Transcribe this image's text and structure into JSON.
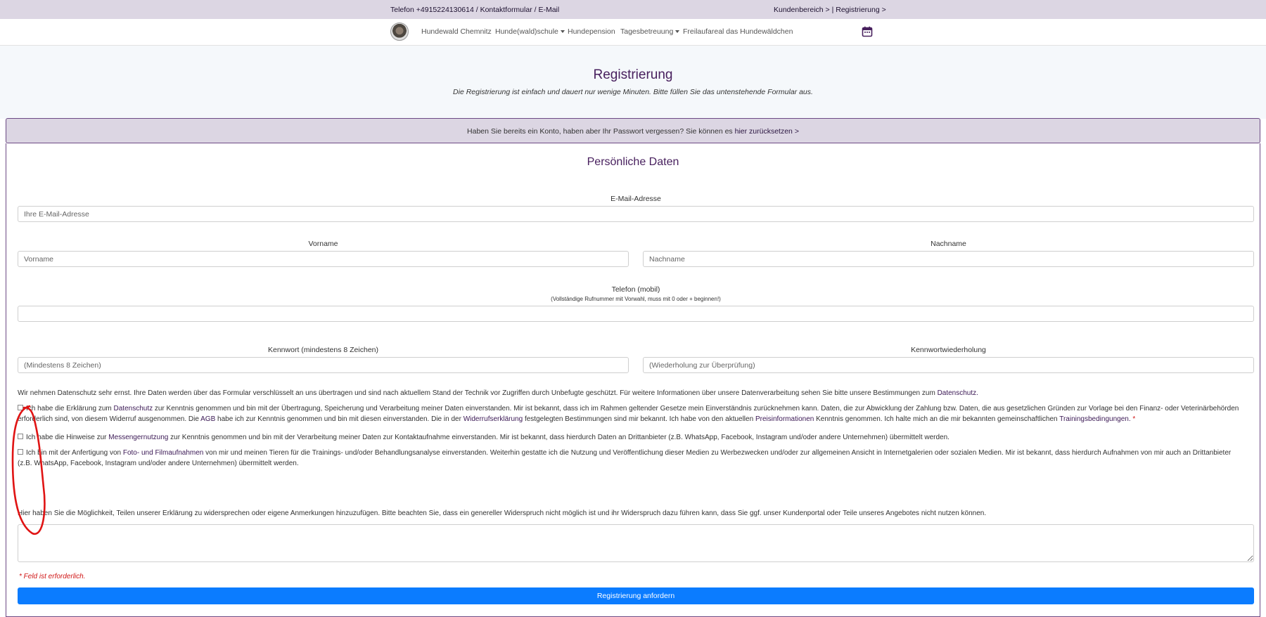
{
  "topbar": {
    "contact": "Telefon +4915224130614 / Kontaktformular / E-Mail",
    "customer": "Kundenbereich > | Registrierung >"
  },
  "nav": {
    "items": [
      "Hundewald Chemnitz",
      "Hunde(wald)schule",
      "Hundepension",
      "Tagesbetreuung",
      "Freilaufareal das Hundewäldchen"
    ],
    "icons": [
      "logo",
      "calendar-icon"
    ]
  },
  "hero": {
    "title": "Registrierung",
    "subtitle": "Die Registrierung ist einfach und dauert nur wenige Minuten. Bitte füllen Sie das untenstehende Formular aus."
  },
  "password_notice": {
    "text": "Haben Sie bereits ein Konto, haben aber Ihr Passwort vergessen? Sie können es ",
    "link": "hier zurücksetzen >"
  },
  "form": {
    "section_title": "Persönliche Daten",
    "email_label": "E-Mail-Adresse",
    "email_placeholder": "Ihre E-Mail-Adresse",
    "firstname_label": "Vorname",
    "firstname_placeholder": "Vorname",
    "lastname_label": "Nachname",
    "lastname_placeholder": "Nachname",
    "phone_label": "Telefon (mobil)",
    "phone_hint": "(Vollständige Rufnummer mit Vorwahl, muss mit 0 oder + beginnen!)",
    "password_label": "Kennwort (mindestens 8 Zeichen)",
    "password_placeholder": "(Mindestens 8 Zeichen)",
    "password_repeat_label": "Kennwortwiederholung",
    "password_repeat_placeholder": "(Wiederholung zur Überprüfung)",
    "privacy_intro": "Wir nehmen Datenschutz sehr ernst. Ihre Daten werden über das Formular verschlüsselt an uns übertragen und sind nach aktuellem Stand der Technik vor Zugriffen durch Unbefugte geschützt. Für weitere Informationen über unsere Datenverarbeitung sehen Sie bitte unsere Bestimmungen zum ",
    "privacy_intro_link": "Datenschutz.",
    "consent1": {
      "p1": "Ich habe die Erklärung zum ",
      "l1": "Datenschutz",
      "p2": " zur Kenntnis genommen und bin mit der Übertragung, Speicherung und Verarbeitung meiner Daten einverstanden. Mir ist bekannt, dass ich im Rahmen geltender Gesetze mein Einverständnis zurücknehmen kann. Daten, die zur Abwicklung der Zahlung bzw. Daten, die aus gesetzlichen Gründen zur Vorlage bei den Finanz- oder Veterinärbehörden erforderlich sind, von diesem Widerruf ausgenommen. Die ",
      "l2": "AGB",
      "p3": " habe ich zur Kenntnis genommen und bin mit diesen einverstanden. Die in der ",
      "l3": "Widerrufserklärung",
      "p4": " festgelegten Bestimmungen sind mir bekannt. Ich habe von den aktuellen ",
      "l4": "Preisinformationen",
      "p5": " Kenntnis genommen. Ich halte mich an die mir bekannten gemeinschaftlichen ",
      "l5": "Trainingsbedingungen.",
      "req": " *"
    },
    "consent2": {
      "p1": "Ich habe die Hinweise zur ",
      "l1": "Messengernutzung",
      "p2": " zur Kenntnis genommen und bin mit der Verarbeitung meiner Daten zur Kontaktaufnahme einverstanden. Mir ist bekannt, dass hierdurch Daten an Drittanbieter (z.B. WhatsApp, Facebook, Instagram und/oder andere Unternehmen) übermittelt werden."
    },
    "consent3": {
      "p1": "Ich bin mit der Anfertigung von ",
      "l1": "Foto- und Filmaufnahmen",
      "p2": " von mir und meinen Tieren für die Trainings- und/oder Behandlungsanalyse einverstanden. Weiterhin gestatte ich die Nutzung und Veröffentlichung dieser Medien zu Werbezwecken und/oder zur allgemeinen Ansicht in Internetgalerien oder sozialen Medien. Mir ist bekannt, dass hierdurch Aufnahmen von mir auch an Drittanbieter (z.B. WhatsApp, Facebook, Instagram und/oder andere Unternehmen) übermittelt werden."
    },
    "objection_text": "Hier haben Sie die Möglichkeit, Teilen unserer Erklärung zu widersprechen oder eigene Anmerkungen hinzuzufügen. Bitte beachten Sie, dass ein genereller Widerspruch nicht möglich ist und ihr Widerspruch dazu führen kann, dass Sie ggf. unser Kundenportal oder Teile unseres Angebotes nicht nutzen können.",
    "required_note": "* Feld ist erforderlich.",
    "submit_label": "Registrierung anfordern"
  },
  "colors": {
    "accent_purple": "#48205e",
    "notice_bg": "#dcd6e3",
    "submit_blue": "#0b7cff",
    "required_red": "#d01616",
    "annotation_red": "#e01414"
  }
}
